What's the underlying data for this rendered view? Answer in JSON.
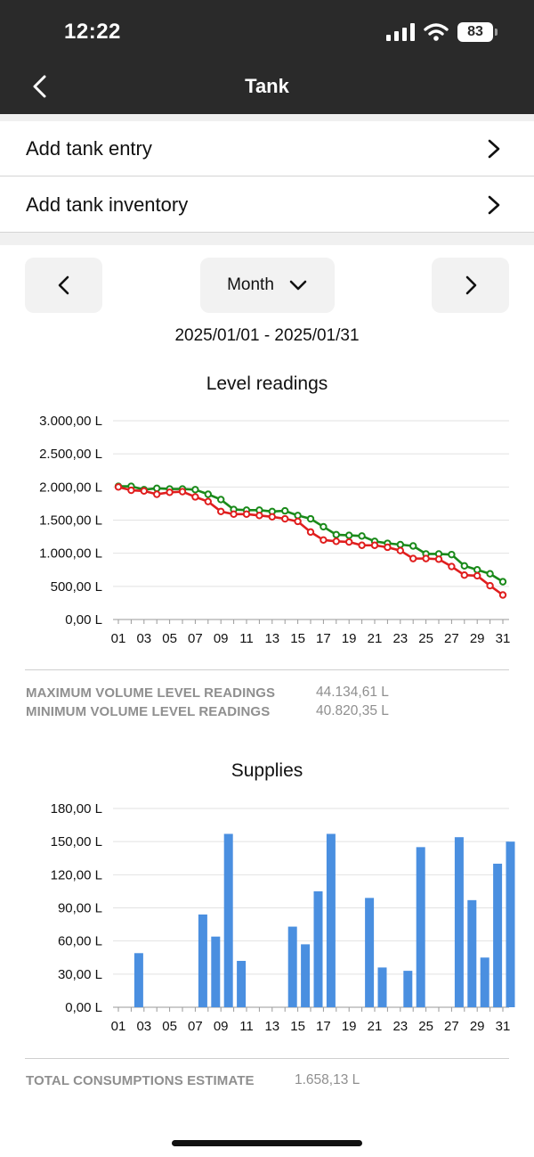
{
  "status_bar": {
    "time": "12:22",
    "battery": "83"
  },
  "header": {
    "title": "Tank"
  },
  "menu": [
    {
      "label": "Add tank entry"
    },
    {
      "label": "Add tank inventory"
    }
  ],
  "period": {
    "selected": "Month",
    "range": "2025/01/01 - 2025/01/31"
  },
  "level_chart": {
    "title": "Level readings",
    "y_tick_labels": [
      "3.000,00 L",
      "2.500,00 L",
      "2.000,00 L",
      "1.500,00 L",
      "1.000,00 L",
      "500,00 L",
      "0,00 L"
    ],
    "x_tick_labels": [
      "01",
      "03",
      "05",
      "07",
      "09",
      "11",
      "13",
      "15",
      "17",
      "19",
      "21",
      "23",
      "25",
      "27",
      "29",
      "31"
    ],
    "colors": {
      "max": "#1a8a1a",
      "min": "#e01e1e"
    }
  },
  "level_stats": {
    "max_label": "MAXIMUM VOLUME LEVEL READINGS",
    "max_value": "44.134,61 L",
    "min_label": "MINIMUM VOLUME LEVEL READINGS",
    "min_value": "40.820,35 L"
  },
  "supplies_chart": {
    "title": "Supplies",
    "y_tick_labels": [
      "180,00 L",
      "150,00 L",
      "120,00 L",
      "90,00 L",
      "60,00 L",
      "30,00 L",
      "0,00 L"
    ],
    "x_tick_labels": [
      "01",
      "03",
      "05",
      "07",
      "09",
      "11",
      "13",
      "15",
      "17",
      "19",
      "21",
      "23",
      "25",
      "27",
      "29",
      "31"
    ],
    "color": "#4a8fe0"
  },
  "consumption": {
    "label": "TOTAL CONSUMPTIONS ESTIMATE",
    "value": "1.658,13 L"
  },
  "chart_data": [
    {
      "type": "line",
      "title": "Level readings",
      "x": [
        1,
        2,
        3,
        4,
        5,
        6,
        7,
        8,
        9,
        10,
        11,
        12,
        13,
        14,
        15,
        16,
        17,
        18,
        19,
        20,
        21,
        22,
        23,
        24,
        25,
        26,
        27,
        28,
        29,
        30,
        31
      ],
      "ylim": [
        0,
        3000
      ],
      "grid": true,
      "series": [
        {
          "values": [
            2010,
            2010,
            1960,
            1980,
            1970,
            1970,
            1960,
            1890,
            1810,
            1660,
            1650,
            1650,
            1630,
            1640,
            1570,
            1520,
            1400,
            1280,
            1270,
            1260,
            1180,
            1150,
            1130,
            1110,
            990,
            990,
            980,
            810,
            750,
            690,
            570
          ]
        },
        {
          "values": [
            2000,
            1950,
            1940,
            1890,
            1920,
            1930,
            1850,
            1780,
            1630,
            1590,
            1590,
            1570,
            1550,
            1520,
            1480,
            1320,
            1200,
            1180,
            1170,
            1120,
            1120,
            1090,
            1040,
            920,
            920,
            910,
            800,
            670,
            660,
            510,
            370
          ]
        }
      ]
    },
    {
      "type": "bar",
      "title": "Supplies",
      "x": [
        1,
        2,
        3,
        4,
        5,
        6,
        7,
        8,
        9,
        10,
        11,
        12,
        13,
        14,
        15,
        16,
        17,
        18,
        19,
        20,
        21,
        22,
        23,
        24,
        25,
        26,
        27,
        28,
        29,
        30,
        31
      ],
      "values": [
        0,
        49,
        0,
        0,
        0,
        0,
        84,
        64,
        157,
        42,
        0,
        0,
        0,
        73,
        57,
        105,
        157,
        0,
        0,
        99,
        36,
        0,
        33,
        145,
        0,
        0,
        154,
        97,
        45,
        130,
        150
      ],
      "ylim": [
        0,
        180
      ],
      "grid": true
    }
  ]
}
